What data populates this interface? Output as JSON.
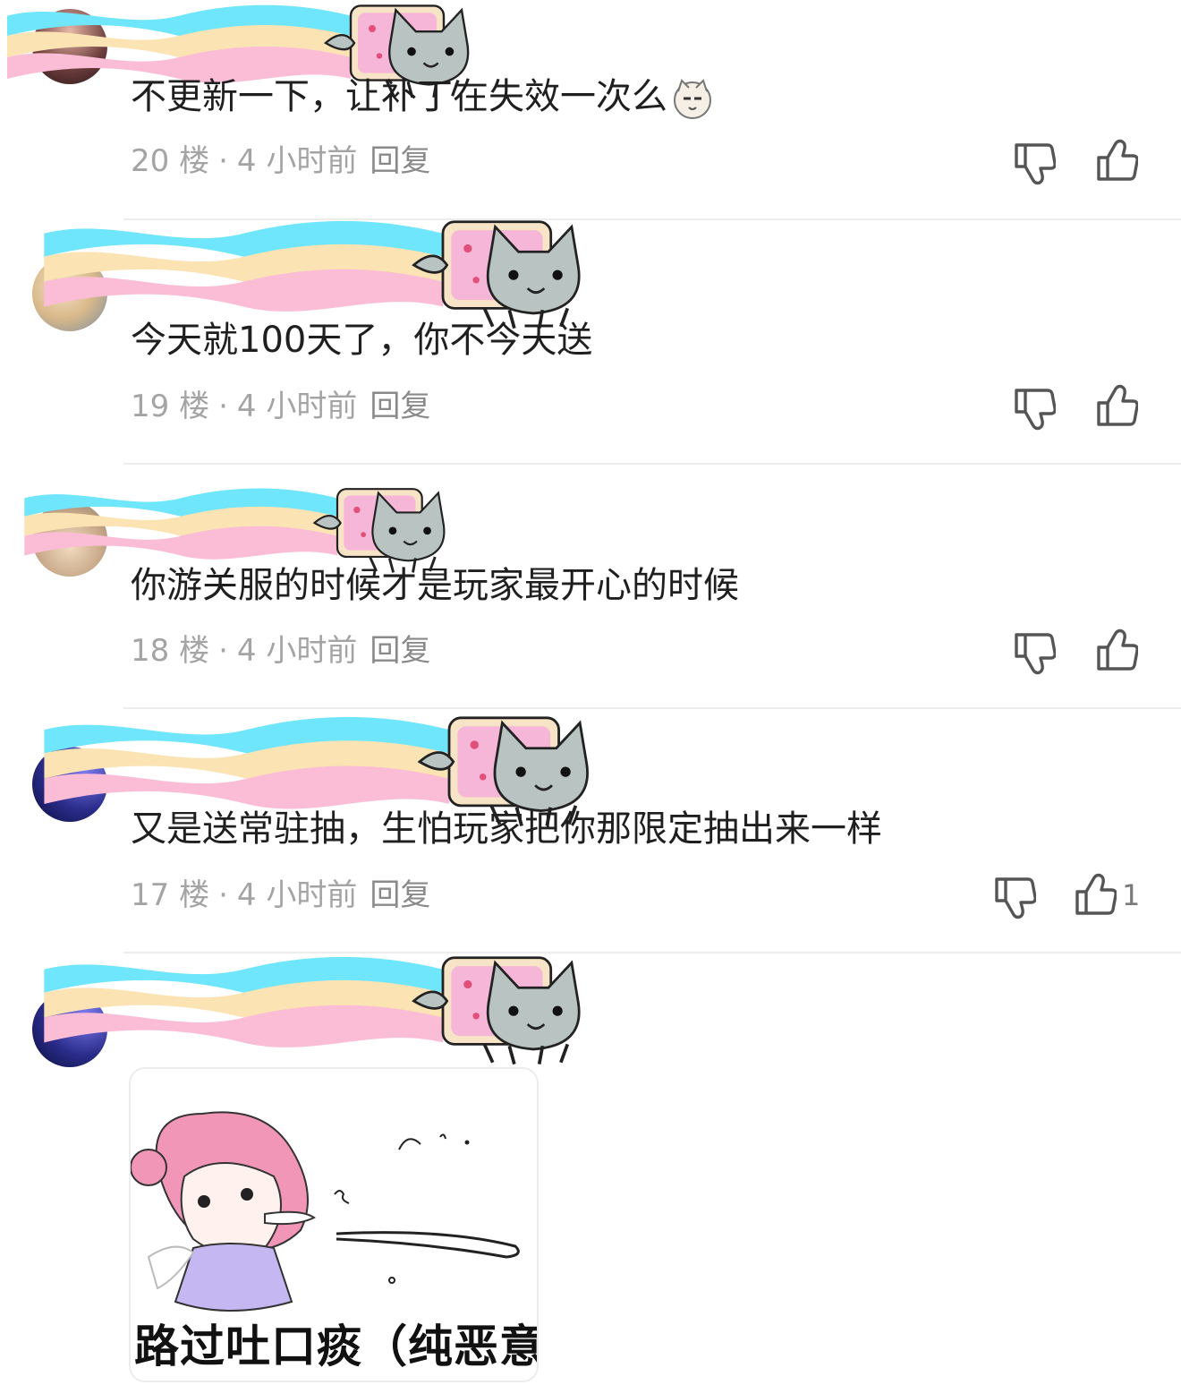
{
  "comments": [
    {
      "text": "不更新一下，让补丁在失效一次么",
      "floor": "20 楼",
      "time": "4 小时前",
      "reply": "回复",
      "likes": "",
      "emoji": "cat-face-emoji"
    },
    {
      "text": "今天就100天了，你不今天送",
      "floor": "19 楼",
      "time": "4 小时前",
      "reply": "回复",
      "likes": ""
    },
    {
      "text": "你游关服的时候才是玩家最开心的时候",
      "floor": "18 楼",
      "time": "4 小时前",
      "reply": "回复",
      "likes": ""
    },
    {
      "text": "又是送常驻抽，生怕玩家把你那限定抽出来一样",
      "floor": "17 楼",
      "time": "4 小时前",
      "reply": "回复",
      "likes": "1"
    },
    {
      "text": "",
      "floor": "",
      "time": "",
      "reply": "",
      "likes": "",
      "image": {
        "caption": "路过吐口痰（纯恶意"
      }
    }
  ],
  "separator": "·",
  "colors": {
    "rainbow_blue": "#6fe6fb",
    "rainbow_yellow": "#fbe3b4",
    "rainbow_pink": "#fbbcd6",
    "cat_gray": "#b9c3c2",
    "poptart": "#f6b6d8",
    "meta_text": "#a4a4a4"
  }
}
